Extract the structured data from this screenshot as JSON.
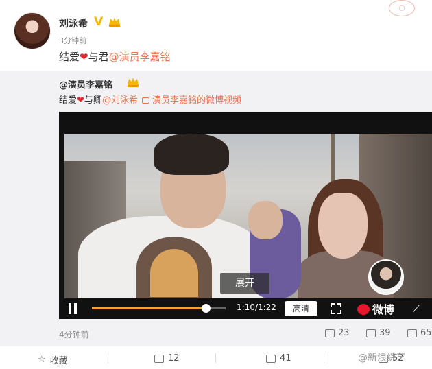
{
  "post": {
    "username": "刘泳希",
    "verified_mark": "V",
    "timestamp": "3分钟前",
    "text_before": "结爱",
    "heart": "❤",
    "text_middle": "与君",
    "mention": "@演员李嘉铭"
  },
  "repost": {
    "username": "@演员李嘉铭",
    "text_before": "结爱",
    "heart": "❤",
    "text_middle": "与卿",
    "mention": "@刘泳希",
    "video_link": "演员李嘉铭的微博视频",
    "timestamp": "4分钟前",
    "stats": {
      "reposts": "23",
      "comments": "39",
      "likes": "65"
    }
  },
  "video": {
    "expand_label": "展开",
    "time": "1:10/1:22",
    "progress_fraction": 0.85,
    "quality_label": "高清",
    "brand_label": "微博"
  },
  "bottom_bar": {
    "favorite_label": "收藏",
    "repost_count": "12",
    "comment_count": "41",
    "like_count": "52",
    "watermark": "@新浪综艺"
  },
  "colors": {
    "accent": "#eb7350",
    "verified": "#f7b500",
    "progress": "#f2a23c"
  },
  "icons": [
    "pause-icon",
    "fullscreen-icon",
    "weibo-logo-icon",
    "mute-icon",
    "repost-icon",
    "comment-icon",
    "like-icon",
    "star-icon"
  ]
}
